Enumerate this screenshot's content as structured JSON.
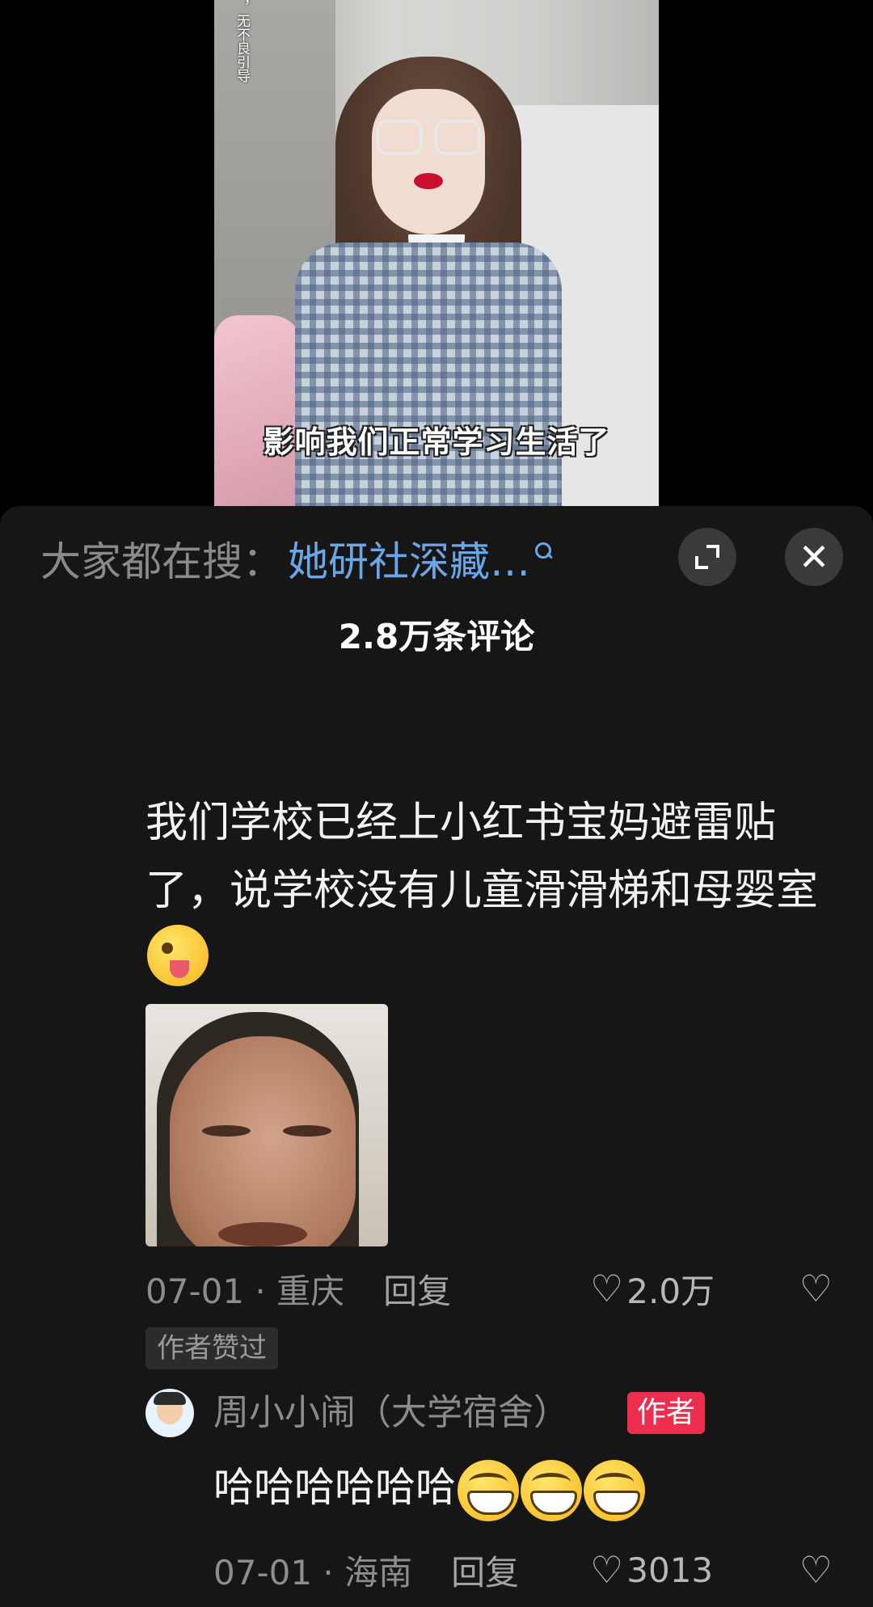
{
  "video": {
    "side_caption": "，无不良引导",
    "subtitle": "影响我们正常学习生活了"
  },
  "search": {
    "prefix": "大家都在搜：",
    "query": "她研社深藏…"
  },
  "panel": {
    "comment_count": "2.8万条评论"
  },
  "comment": {
    "text": "我们学校已经上小红书宝妈避雷贴了，说学校没有儿童滑滑梯和母婴室",
    "emoji": "wink-tongue-emoji",
    "date_location": "07-01 · 重庆",
    "reply_label": "回复",
    "like_count": "2.0万",
    "author_liked_tag": "作者赞过"
  },
  "reply": {
    "username": "周小小闹（大学宿舍）",
    "author_badge": "作者",
    "text": "哈哈哈哈哈哈",
    "emojis": [
      "grin-emoji",
      "grin-emoji",
      "grin-emoji"
    ],
    "date_location": "07-01 · 海南",
    "reply_label": "回复",
    "like_count": "3013"
  },
  "colors": {
    "panel_bg": "#161616",
    "search_link": "#6aa7e8",
    "author_badge": "#ee2e4f"
  }
}
